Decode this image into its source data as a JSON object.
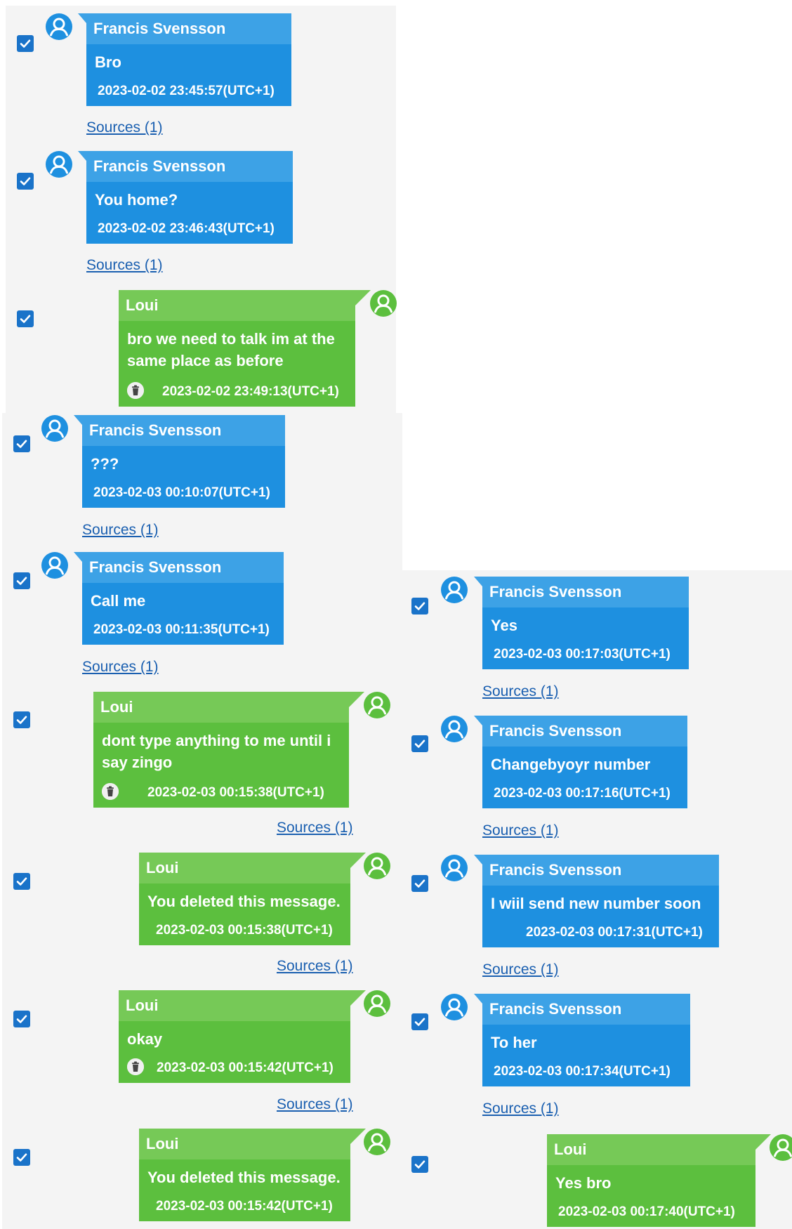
{
  "colors": {
    "blue": "#1e90e0",
    "green": "#5cbf3e",
    "link": "#1a5fb0",
    "checkbox": "#1a73c9"
  },
  "sources_label": "Sources (1)",
  "messages": [
    {
      "sender": "Francis Svensson",
      "text": "Bro",
      "time": "2023-02-02 23:45:57(UTC+1)",
      "side": "in",
      "checked": true
    },
    {
      "sender": "Francis Svensson",
      "text": "You home?",
      "time": "2023-02-02 23:46:43(UTC+1)",
      "side": "in",
      "checked": true
    },
    {
      "sender": "Loui",
      "text": "bro we need to talk im at the same place as before",
      "time": "2023-02-02 23:49:13(UTC+1)",
      "side": "out",
      "deleted_icon": true,
      "checked": true
    },
    {
      "sender": "Francis Svensson",
      "text": "???",
      "time": "2023-02-03 00:10:07(UTC+1)",
      "side": "in",
      "checked": true
    },
    {
      "sender": "Francis Svensson",
      "text": "Call me",
      "time": "2023-02-03 00:11:35(UTC+1)",
      "side": "in",
      "checked": true
    },
    {
      "sender": "Loui",
      "text": "dont type anything to me until i say zingo",
      "time": "2023-02-03 00:15:38(UTC+1)",
      "side": "out",
      "deleted_icon": true,
      "checked": true
    },
    {
      "sender": "Loui",
      "text": "You deleted this message.",
      "time": "2023-02-03 00:15:38(UTC+1)",
      "side": "out",
      "checked": true
    },
    {
      "sender": "Loui",
      "text": "okay",
      "time": "2023-02-03 00:15:42(UTC+1)",
      "side": "out",
      "deleted_icon": true,
      "checked": true
    },
    {
      "sender": "Loui",
      "text": "You deleted this message.",
      "time": "2023-02-03 00:15:42(UTC+1)",
      "side": "out",
      "checked": true
    },
    {
      "sender": "Francis Svensson",
      "text": "Yes",
      "time": "2023-02-03 00:17:03(UTC+1)",
      "side": "in",
      "checked": true
    },
    {
      "sender": "Francis Svensson",
      "text": "Changebyoyr number",
      "time": "2023-02-03 00:17:16(UTC+1)",
      "side": "in",
      "checked": true
    },
    {
      "sender": "Francis Svensson",
      "text": "I wiil send new number soon",
      "time": "2023-02-03 00:17:31(UTC+1)",
      "side": "in",
      "checked": true
    },
    {
      "sender": "Francis Svensson",
      "text": "To her",
      "time": "2023-02-03 00:17:34(UTC+1)",
      "side": "in",
      "checked": true
    },
    {
      "sender": "Loui",
      "text": "Yes bro",
      "time": "2023-02-03 00:17:40(UTC+1)",
      "side": "out",
      "checked": true
    }
  ]
}
